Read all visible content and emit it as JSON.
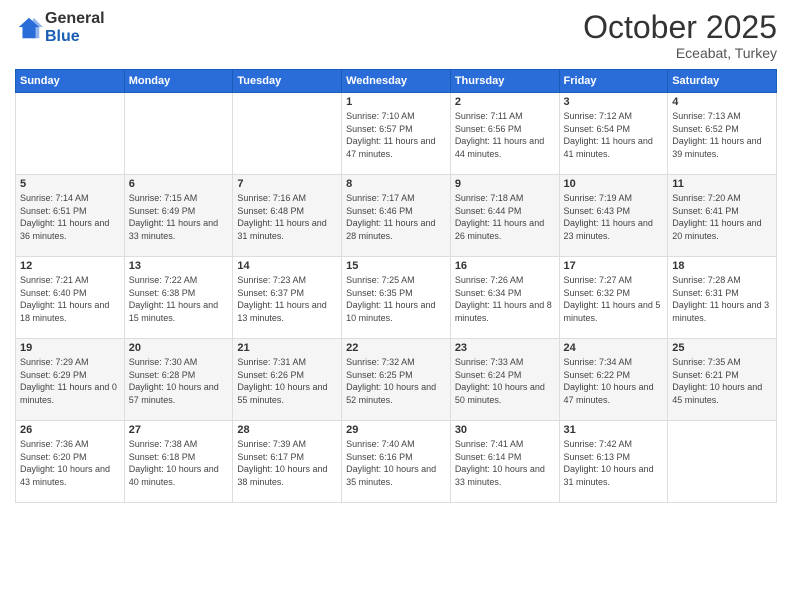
{
  "logo": {
    "general": "General",
    "blue": "Blue"
  },
  "header": {
    "month": "October 2025",
    "location": "Eceabat, Turkey"
  },
  "weekdays": [
    "Sunday",
    "Monday",
    "Tuesday",
    "Wednesday",
    "Thursday",
    "Friday",
    "Saturday"
  ],
  "weeks": [
    [
      {
        "day": "",
        "info": ""
      },
      {
        "day": "",
        "info": ""
      },
      {
        "day": "",
        "info": ""
      },
      {
        "day": "1",
        "info": "Sunrise: 7:10 AM\nSunset: 6:57 PM\nDaylight: 11 hours and 47 minutes."
      },
      {
        "day": "2",
        "info": "Sunrise: 7:11 AM\nSunset: 6:56 PM\nDaylight: 11 hours and 44 minutes."
      },
      {
        "day": "3",
        "info": "Sunrise: 7:12 AM\nSunset: 6:54 PM\nDaylight: 11 hours and 41 minutes."
      },
      {
        "day": "4",
        "info": "Sunrise: 7:13 AM\nSunset: 6:52 PM\nDaylight: 11 hours and 39 minutes."
      }
    ],
    [
      {
        "day": "5",
        "info": "Sunrise: 7:14 AM\nSunset: 6:51 PM\nDaylight: 11 hours and 36 minutes."
      },
      {
        "day": "6",
        "info": "Sunrise: 7:15 AM\nSunset: 6:49 PM\nDaylight: 11 hours and 33 minutes."
      },
      {
        "day": "7",
        "info": "Sunrise: 7:16 AM\nSunset: 6:48 PM\nDaylight: 11 hours and 31 minutes."
      },
      {
        "day": "8",
        "info": "Sunrise: 7:17 AM\nSunset: 6:46 PM\nDaylight: 11 hours and 28 minutes."
      },
      {
        "day": "9",
        "info": "Sunrise: 7:18 AM\nSunset: 6:44 PM\nDaylight: 11 hours and 26 minutes."
      },
      {
        "day": "10",
        "info": "Sunrise: 7:19 AM\nSunset: 6:43 PM\nDaylight: 11 hours and 23 minutes."
      },
      {
        "day": "11",
        "info": "Sunrise: 7:20 AM\nSunset: 6:41 PM\nDaylight: 11 hours and 20 minutes."
      }
    ],
    [
      {
        "day": "12",
        "info": "Sunrise: 7:21 AM\nSunset: 6:40 PM\nDaylight: 11 hours and 18 minutes."
      },
      {
        "day": "13",
        "info": "Sunrise: 7:22 AM\nSunset: 6:38 PM\nDaylight: 11 hours and 15 minutes."
      },
      {
        "day": "14",
        "info": "Sunrise: 7:23 AM\nSunset: 6:37 PM\nDaylight: 11 hours and 13 minutes."
      },
      {
        "day": "15",
        "info": "Sunrise: 7:25 AM\nSunset: 6:35 PM\nDaylight: 11 hours and 10 minutes."
      },
      {
        "day": "16",
        "info": "Sunrise: 7:26 AM\nSunset: 6:34 PM\nDaylight: 11 hours and 8 minutes."
      },
      {
        "day": "17",
        "info": "Sunrise: 7:27 AM\nSunset: 6:32 PM\nDaylight: 11 hours and 5 minutes."
      },
      {
        "day": "18",
        "info": "Sunrise: 7:28 AM\nSunset: 6:31 PM\nDaylight: 11 hours and 3 minutes."
      }
    ],
    [
      {
        "day": "19",
        "info": "Sunrise: 7:29 AM\nSunset: 6:29 PM\nDaylight: 11 hours and 0 minutes."
      },
      {
        "day": "20",
        "info": "Sunrise: 7:30 AM\nSunset: 6:28 PM\nDaylight: 10 hours and 57 minutes."
      },
      {
        "day": "21",
        "info": "Sunrise: 7:31 AM\nSunset: 6:26 PM\nDaylight: 10 hours and 55 minutes."
      },
      {
        "day": "22",
        "info": "Sunrise: 7:32 AM\nSunset: 6:25 PM\nDaylight: 10 hours and 52 minutes."
      },
      {
        "day": "23",
        "info": "Sunrise: 7:33 AM\nSunset: 6:24 PM\nDaylight: 10 hours and 50 minutes."
      },
      {
        "day": "24",
        "info": "Sunrise: 7:34 AM\nSunset: 6:22 PM\nDaylight: 10 hours and 47 minutes."
      },
      {
        "day": "25",
        "info": "Sunrise: 7:35 AM\nSunset: 6:21 PM\nDaylight: 10 hours and 45 minutes."
      }
    ],
    [
      {
        "day": "26",
        "info": "Sunrise: 7:36 AM\nSunset: 6:20 PM\nDaylight: 10 hours and 43 minutes."
      },
      {
        "day": "27",
        "info": "Sunrise: 7:38 AM\nSunset: 6:18 PM\nDaylight: 10 hours and 40 minutes."
      },
      {
        "day": "28",
        "info": "Sunrise: 7:39 AM\nSunset: 6:17 PM\nDaylight: 10 hours and 38 minutes."
      },
      {
        "day": "29",
        "info": "Sunrise: 7:40 AM\nSunset: 6:16 PM\nDaylight: 10 hours and 35 minutes."
      },
      {
        "day": "30",
        "info": "Sunrise: 7:41 AM\nSunset: 6:14 PM\nDaylight: 10 hours and 33 minutes."
      },
      {
        "day": "31",
        "info": "Sunrise: 7:42 AM\nSunset: 6:13 PM\nDaylight: 10 hours and 31 minutes."
      },
      {
        "day": "",
        "info": ""
      }
    ]
  ]
}
